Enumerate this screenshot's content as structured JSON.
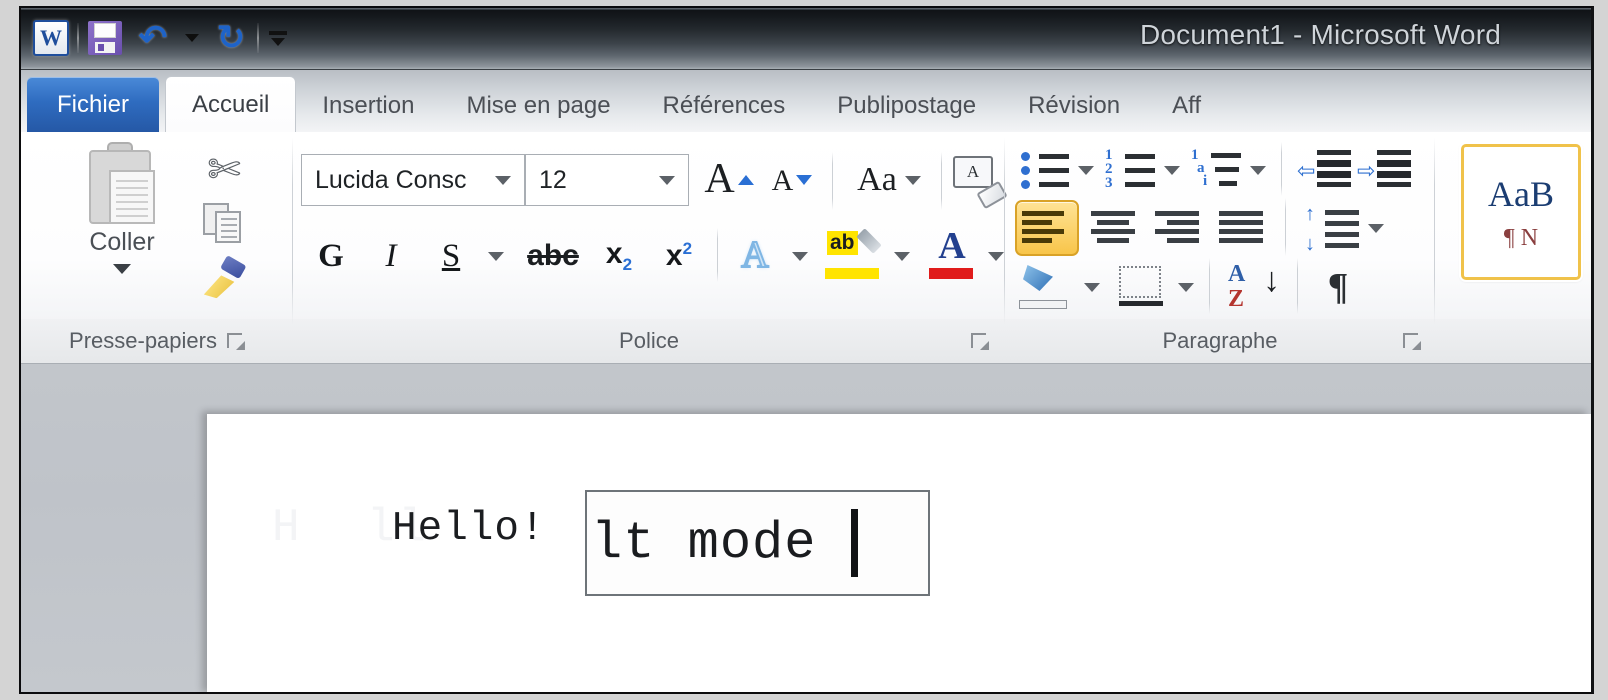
{
  "window": {
    "title": "Document1  -  Microsoft Word"
  },
  "quick_access": {
    "app_icon_letter": "W",
    "items": [
      {
        "name": "save",
        "icon": "save-icon"
      },
      {
        "name": "undo",
        "icon": "undo-icon",
        "glyph": "↰"
      },
      {
        "name": "undo-dropdown",
        "icon": "chevron-down-icon"
      },
      {
        "name": "redo",
        "icon": "redo-icon",
        "glyph": "↻"
      },
      {
        "name": "customize",
        "icon": "customize-toolbar-icon"
      }
    ]
  },
  "ribbon": {
    "tabs": [
      {
        "id": "fichier",
        "label": "Fichier",
        "state": "file"
      },
      {
        "id": "accueil",
        "label": "Accueil",
        "state": "active"
      },
      {
        "id": "insertion",
        "label": "Insertion",
        "state": "normal"
      },
      {
        "id": "mise-en-page",
        "label": "Mise en page",
        "state": "normal"
      },
      {
        "id": "references",
        "label": "Références",
        "state": "normal"
      },
      {
        "id": "publipostage",
        "label": "Publipostage",
        "state": "normal"
      },
      {
        "id": "revision",
        "label": "Révision",
        "state": "normal"
      },
      {
        "id": "affichage",
        "label": "Aff",
        "state": "normal"
      }
    ],
    "groups": {
      "clipboard": {
        "label": "Presse-papiers",
        "paste_label": "Coller",
        "buttons": [
          "couper",
          "copier",
          "reproduire-mise-en-forme"
        ]
      },
      "font": {
        "label": "Police",
        "font_name": "Lucida Consc",
        "font_size": "12",
        "bold": "G",
        "italic": "I",
        "underline": "S",
        "strikethrough": "abc",
        "subscript": "x",
        "subscript_index": "2",
        "superscript": "x",
        "superscript_index": "2",
        "case_label": "Aa",
        "clear_label": "A"
      },
      "paragraph": {
        "label": "Paragraphe",
        "active_alignment": "align-left"
      },
      "styles": {
        "preview_big": "AaB",
        "preview_small": "¶ N"
      }
    }
  },
  "document": {
    "ghost_text": "H  ll",
    "text_before": "Hello!",
    "selected_text": "lt mode ",
    "caret": "|"
  }
}
